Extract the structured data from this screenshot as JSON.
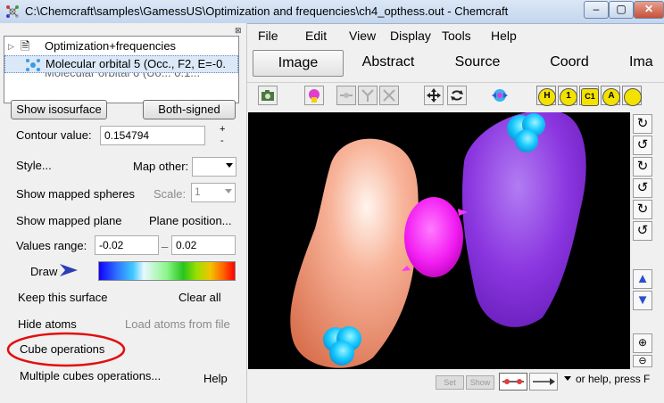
{
  "window": {
    "title": "C:\\Chemcraft\\samples\\GamessUS\\Optimization and frequencies\\ch4_opthess.out - Chemcraft",
    "minimize": "–",
    "maximize": "▢",
    "close": "✕"
  },
  "tree": {
    "items": [
      {
        "label": "Optimization+frequencies"
      },
      {
        "label": "Molecular orbital  5 (Occ., F2, E=-0.",
        "selected": true
      },
      {
        "label": "Molecular orbital  6 (Uo...  0.1..."
      }
    ]
  },
  "left": {
    "show_isosurface": "Show isosurface",
    "both_signed": "Both-signed",
    "contour_label": "Contour value:",
    "contour_value": "0.154794",
    "plus": "+",
    "minus": "-",
    "style": "Style...",
    "map_other": "Map other:",
    "show_mapped_spheres": "Show mapped spheres",
    "scale_label": "Scale:",
    "scale_value": "1",
    "show_mapped_plane": "Show mapped plane",
    "plane_position": "Plane position...",
    "values_range_label": "Values range:",
    "range_min": "-0.02",
    "range_dash": "_",
    "range_max": "0.02",
    "draw": "Draw",
    "keep_surface": "Keep this surface",
    "clear_all": "Clear all",
    "hide_atoms": "Hide atoms",
    "load_atoms": "Load atoms from file",
    "cube_operations": "Cube operations",
    "multiple_cubes": "Multiple cubes operations...",
    "help": "Help"
  },
  "menu": [
    "File",
    "Edit",
    "View",
    "Display",
    "Tools",
    "Help"
  ],
  "tabs": [
    "Image",
    "Abstract",
    "Source",
    "Coord",
    "Ima"
  ],
  "toolbar": {
    "label_buttons": [
      "H",
      "1",
      "C1",
      "A",
      ""
    ]
  },
  "status": {
    "set": "Set",
    "show": "Show",
    "help_text": "or help, press F"
  },
  "colors": {
    "highlight_circle": "#e01010",
    "lobe_positive": "#f4a58a",
    "lobe_negative": "#8c2fd6",
    "atom_h": "#13c8ff",
    "atom_c": "#f21ef2",
    "accent": "#3a5fcd"
  }
}
